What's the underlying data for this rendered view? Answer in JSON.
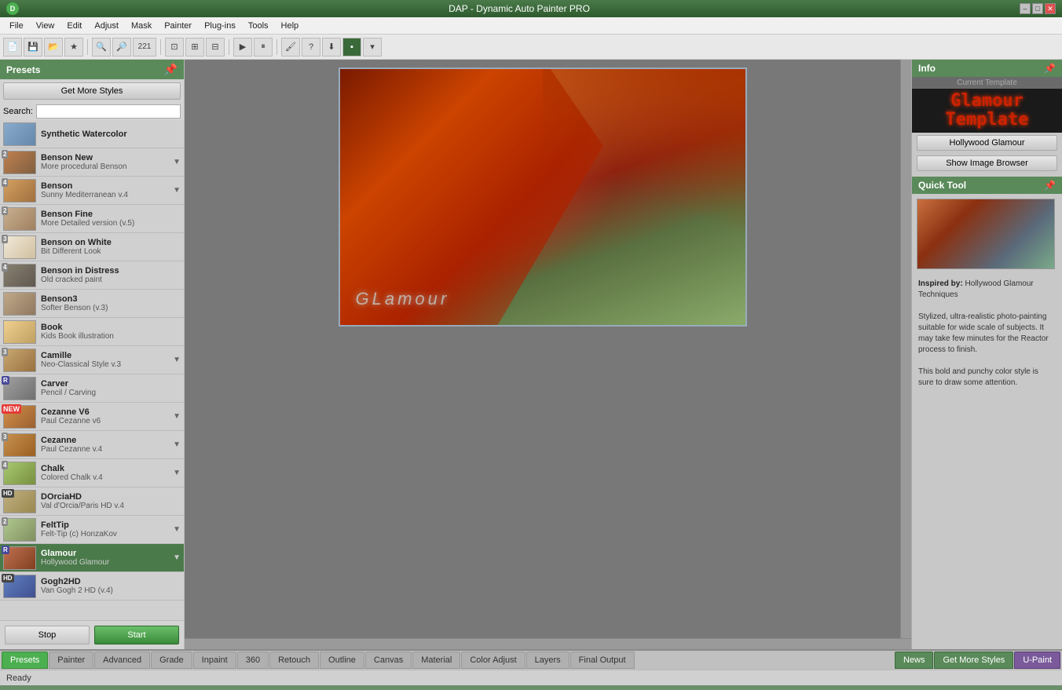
{
  "app": {
    "title": "DAP - Dynamic Auto Painter PRO",
    "icon_label": "D"
  },
  "title_bar": {
    "minimize_label": "–",
    "maximize_label": "□",
    "close_label": "✕"
  },
  "menu": {
    "items": [
      "File",
      "View",
      "Edit",
      "Adjust",
      "Mask",
      "Painter",
      "Plug-ins",
      "Tools",
      "Help"
    ]
  },
  "sidebar": {
    "title": "Presets",
    "get_more_label": "Get More Styles",
    "search_label": "Search:",
    "search_placeholder": "",
    "presets": [
      {
        "id": "synthetic-watercolor",
        "name": "Synthetic Watercolor",
        "sub": "",
        "badge": "",
        "selected": false,
        "has_arrow": false
      },
      {
        "id": "benson-new",
        "name": "Benson New",
        "sub": "More procedural Benson",
        "badge": "2",
        "badge_type": "num",
        "selected": false,
        "has_arrow": true
      },
      {
        "id": "benson",
        "name": "Benson",
        "sub": "Sunny Mediterranean v.4",
        "badge": "4",
        "badge_type": "num",
        "selected": false,
        "has_arrow": true
      },
      {
        "id": "benson-fine",
        "name": "Benson Fine",
        "sub": "More Detailed version (v.5)",
        "badge": "2",
        "badge_type": "num",
        "selected": false,
        "has_arrow": false
      },
      {
        "id": "benson-on-white",
        "name": "Benson on White",
        "sub": "Bit Different Look",
        "badge": "3",
        "badge_type": "num",
        "selected": false,
        "has_arrow": false
      },
      {
        "id": "benson-in-distress",
        "name": "Benson in Distress",
        "sub": "Old cracked paint",
        "badge": "4",
        "badge_type": "num",
        "selected": false,
        "has_arrow": false
      },
      {
        "id": "benson3",
        "name": "Benson3",
        "sub": "Softer Benson (v.3)",
        "badge": "",
        "badge_type": "",
        "selected": false,
        "has_arrow": false
      },
      {
        "id": "book",
        "name": "Book",
        "sub": "Kids Book illustration",
        "badge": "",
        "badge_type": "",
        "selected": false,
        "has_arrow": false
      },
      {
        "id": "camille",
        "name": "Camille",
        "sub": "Neo-Classical Style v.3",
        "badge": "3",
        "badge_type": "num",
        "selected": false,
        "has_arrow": true
      },
      {
        "id": "carver",
        "name": "Carver",
        "sub": "Pencil / Carving",
        "badge": "R",
        "badge_type": "r",
        "selected": false,
        "has_arrow": false
      },
      {
        "id": "cezanne-v6",
        "name": "Cezanne V6",
        "sub": "Paul Cezanne v6",
        "badge": "NEW",
        "badge_type": "new",
        "selected": false,
        "has_arrow": true
      },
      {
        "id": "cezanne",
        "name": "Cezanne",
        "sub": "Paul Cezanne v.4",
        "badge": "3",
        "badge_type": "num",
        "selected": false,
        "has_arrow": true
      },
      {
        "id": "chalk",
        "name": "Chalk",
        "sub": "Colored Chalk v.4",
        "badge": "4",
        "badge_type": "num",
        "selected": false,
        "has_arrow": true
      },
      {
        "id": "dorciahd",
        "name": "DOrciaHD",
        "sub": "Val d'Orcia/Paris HD v.4",
        "badge": "HD",
        "badge_type": "hd",
        "selected": false,
        "has_arrow": false
      },
      {
        "id": "felttip",
        "name": "FeltTip",
        "sub": "Felt-Tip (c) HonzaKov",
        "badge": "2",
        "badge_type": "num",
        "selected": false,
        "has_arrow": true
      },
      {
        "id": "glamour",
        "name": "Glamour",
        "sub": "Hollywood Glamour",
        "badge": "R",
        "badge_type": "r",
        "selected": true,
        "has_arrow": true
      },
      {
        "id": "gogh2hd",
        "name": "Gogh2HD",
        "sub": "Van Gogh 2 HD (v.4)",
        "badge": "HD",
        "badge_type": "hd",
        "selected": false,
        "has_arrow": false
      }
    ],
    "stop_label": "Stop",
    "start_label": "Start"
  },
  "canvas": {
    "overlay_text": "GLamour"
  },
  "info_panel": {
    "title": "Info",
    "current_template_label": "Current Template",
    "template_name_line1": "Glamour",
    "template_name_line2": "Template",
    "hollywood_glamour_label": "Hollywood Glamour",
    "show_browser_label": "Show Image Browser",
    "quick_tool_label": "Quick Tool",
    "inspired_label": "Inspired by:",
    "inspired_text": "Hollywood Glamour Techniques",
    "description1": "Stylized, ultra-realistic photo-painting suitable for wide scale of subjects. It may take few minutes for the Reactor process to finish.",
    "description2": "This bold and punchy color style is sure to draw some attention."
  },
  "bottom_tabs": {
    "tabs": [
      "Presets",
      "Painter",
      "Advanced",
      "Grade",
      "Inpaint",
      "360",
      "Retouch",
      "Outline",
      "Canvas",
      "Material",
      "Color Adjust",
      "Layers",
      "Final Output"
    ],
    "active_tab": "Presets",
    "right_tabs": [
      "News",
      "Get More Styles",
      "U-Paint"
    ]
  },
  "status_bar": {
    "text": "Ready"
  }
}
